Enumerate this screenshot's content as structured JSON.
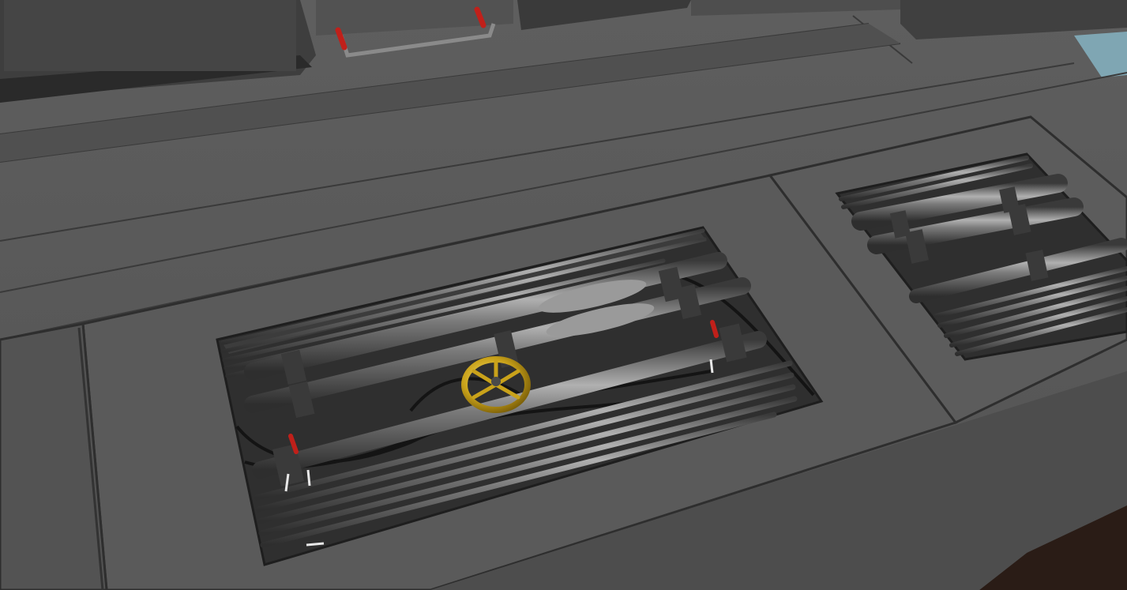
{
  "scene": {
    "description_visible_text": [],
    "palette": {
      "floor": "#585858",
      "floor_dark": "#3d3d3d",
      "panel_edge": "#2a2a2a",
      "pit": "#2e2e2e",
      "pipe_light": "#9a9a9a",
      "pipe_mid": "#6e6e6e",
      "pipe_dark": "#3a3a3a",
      "valve_gold": "#c9a21a",
      "handle_red": "#c0201a",
      "cable": "#141414",
      "corner_blue": "#7fa6b3",
      "corner_brown": "#2a1c16"
    },
    "objects": {
      "main_pit": "main-pipe-trench",
      "side_pit": "side-pipe-trench",
      "valve": "gold-handwheel-valve",
      "levers": [
        "red-lever-left",
        "red-lever-center",
        "red-lever-right"
      ]
    }
  }
}
